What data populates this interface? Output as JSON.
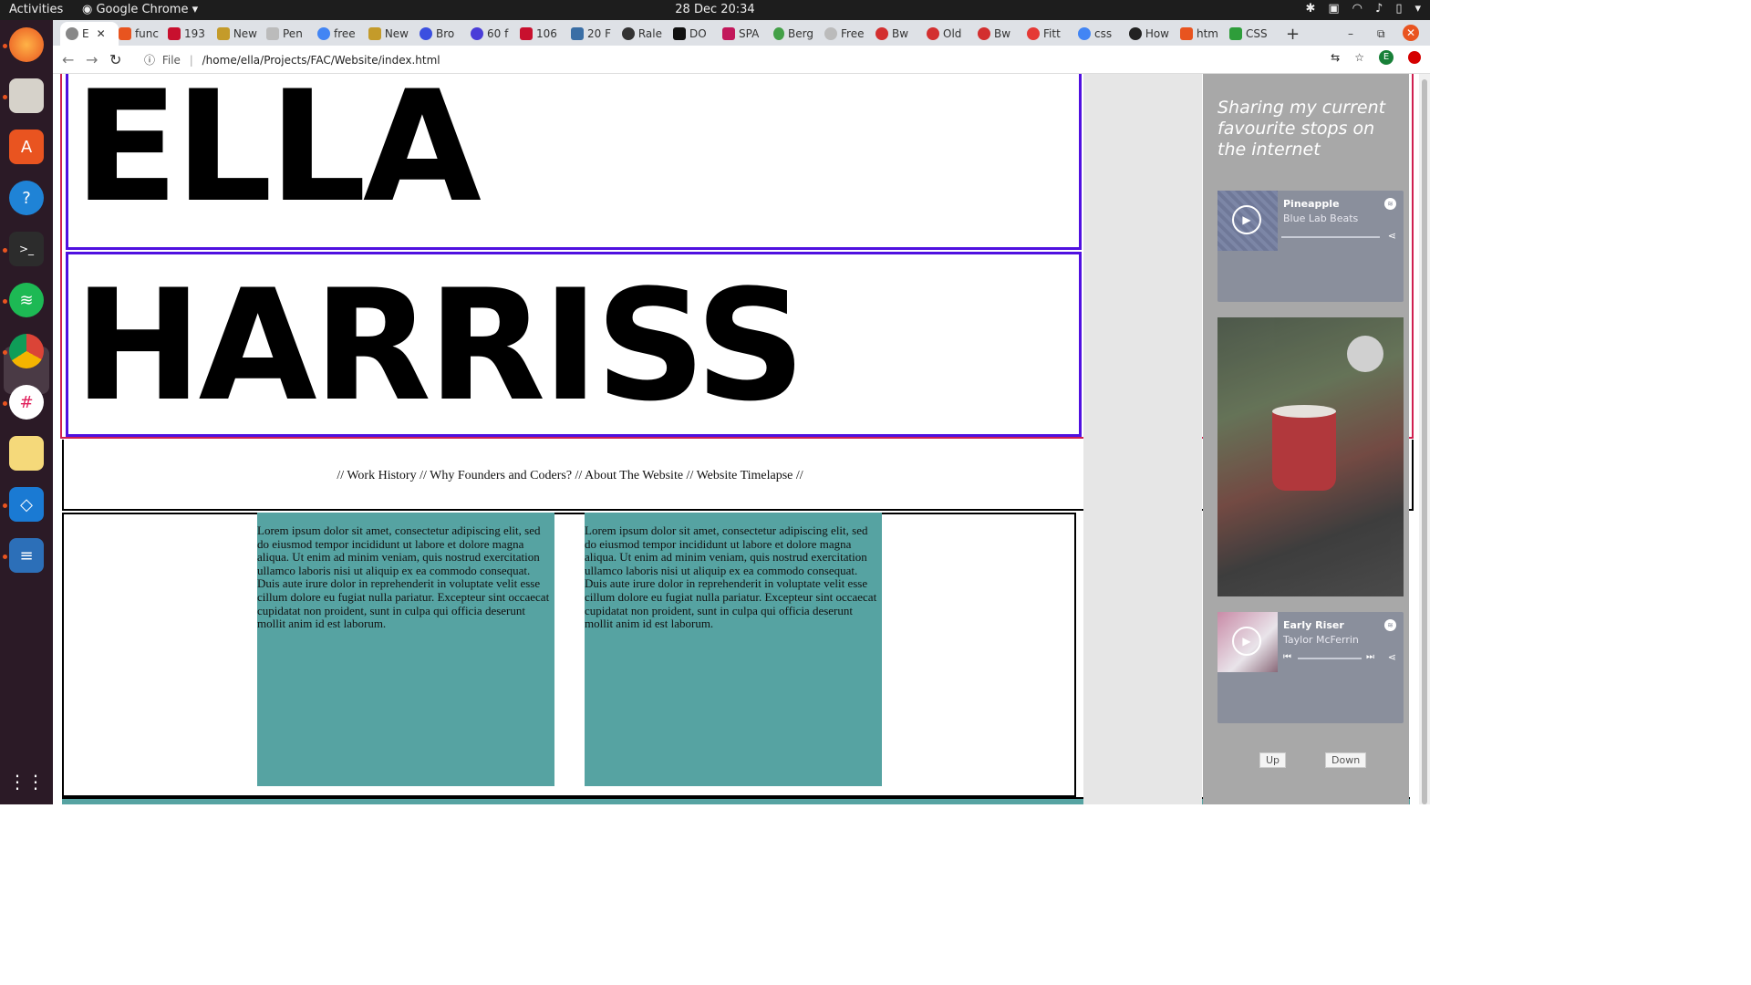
{
  "system": {
    "activities": "Activities",
    "app_name": "Google Chrome",
    "clock": "28 Dec  20:34"
  },
  "tabs": [
    {
      "label": "E",
      "active": true
    },
    {
      "label": "func"
    },
    {
      "label": "193"
    },
    {
      "label": "New"
    },
    {
      "label": "Pen"
    },
    {
      "label": "free"
    },
    {
      "label": "New"
    },
    {
      "label": "Bro"
    },
    {
      "label": "60 f"
    },
    {
      "label": "106"
    },
    {
      "label": "20 F"
    },
    {
      "label": "Rale"
    },
    {
      "label": "DO"
    },
    {
      "label": "SPA"
    },
    {
      "label": "Berg"
    },
    {
      "label": "Free"
    },
    {
      "label": "Bw"
    },
    {
      "label": "Old"
    },
    {
      "label": "Bw"
    },
    {
      "label": "Fitt"
    },
    {
      "label": "css"
    },
    {
      "label": "How"
    },
    {
      "label": "htm"
    },
    {
      "label": "CSS"
    }
  ],
  "toolbar": {
    "file_label": "File",
    "url": "/home/ella/Projects/FAC/Website/index.html",
    "profile_initial": "E"
  },
  "page": {
    "first_name": "ELLA",
    "last_name": "HARRISS",
    "nav": "// Work History // Why Founders and Coders? // About The Website // Website Timelapse //",
    "card1_text": "Lorem ipsum dolor sit amet, consectetur adipiscing elit, sed do eiusmod tempor incididunt ut labore et dolore magna aliqua. Ut enim ad minim veniam, quis nostrud exercitation ullamco laboris nisi ut aliquip ex ea commodo consequat. Duis aute irure dolor in reprehenderit in voluptate velit esse cillum dolore eu fugiat nulla pariatur. Excepteur sint occaecat cupidatat non proident, sunt in culpa qui officia deserunt mollit anim id est laborum.",
    "card2_text": "Lorem ipsum dolor sit amet, consectetur adipiscing elit, sed do eiusmod tempor incididunt ut labore et dolore magna aliqua. Ut enim ad minim veniam, quis nostrud exercitation ullamco laboris nisi ut aliquip ex ea commodo consequat. Duis aute irure dolor in reprehenderit in voluptate velit esse cillum dolore eu fugiat nulla pariatur. Excepteur sint occaecat cupidatat non proident, sunt in culpa qui officia deserunt mollit anim id est laborum."
  },
  "sidebar": {
    "title": "Sharing my current favourite stops on the internet",
    "track1": {
      "title": "Pineapple",
      "artist": "Blue Lab Beats"
    },
    "track2": {
      "title": "Early Riser",
      "artist": "Taylor McFerrin"
    },
    "up_label": "Up",
    "down_label": "Down"
  },
  "colors": {
    "card_teal": "#56a3a2",
    "name_border": "#5010e0",
    "header_border": "#d02050"
  }
}
